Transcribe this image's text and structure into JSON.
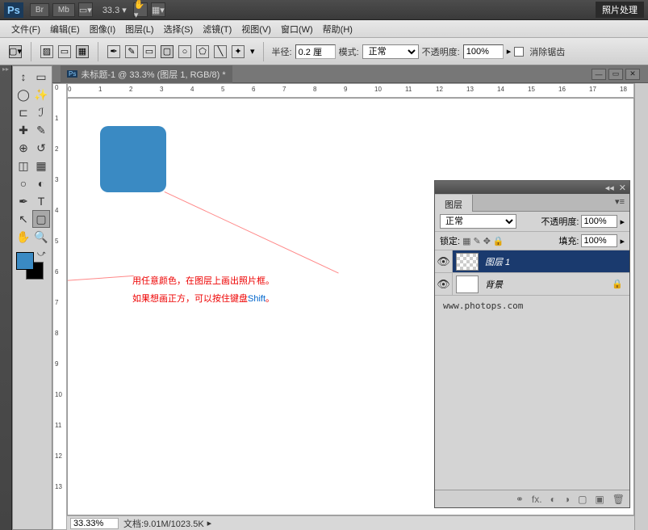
{
  "topbar": {
    "logo": "Ps",
    "btn_br": "Br",
    "btn_mb": "Mb",
    "zoom": "33.3",
    "right_label": "照片处理"
  },
  "menu": [
    "文件(F)",
    "编辑(E)",
    "图像(I)",
    "图层(L)",
    "选择(S)",
    "滤镜(T)",
    "视图(V)",
    "窗口(W)",
    "帮助(H)"
  ],
  "options": {
    "radius_label": "半径:",
    "radius_val": "0.2 厘",
    "mode_label": "模式:",
    "mode_val": "正常",
    "opacity_label": "不透明度:",
    "opacity_val": "100%",
    "aa_label": "消除锯齿"
  },
  "doc": {
    "title": "未标题-1 @ 33.3% (图层 1, RGB/8) *"
  },
  "ruler_h": [
    "0",
    "1",
    "2",
    "3",
    "4",
    "5",
    "6",
    "7",
    "8",
    "9",
    "10",
    "11",
    "12",
    "13",
    "14",
    "15",
    "16",
    "17",
    "18"
  ],
  "ruler_v": [
    "0",
    "1",
    "2",
    "3",
    "4",
    "5",
    "6",
    "7",
    "8",
    "9",
    "10",
    "11",
    "12",
    "13"
  ],
  "annotation": {
    "line1": "用任意颜色，在图层上画出照片框。",
    "line2a": "如果想画正方，可以按住键盘",
    "line2b": "Shift",
    "line2c": "。"
  },
  "status": {
    "zoom": "33.33%",
    "doc": "文档:9.01M/1023.5K"
  },
  "layers": {
    "title": "图层",
    "blend": "正常",
    "opacity_label": "不透明度:",
    "opacity": "100%",
    "lock_label": "锁定:",
    "fill_label": "填充:",
    "fill": "100%",
    "items": [
      {
        "name": "图层 1",
        "locked": false
      },
      {
        "name": "背景",
        "locked": true
      }
    ],
    "url": "www.photops.com"
  }
}
